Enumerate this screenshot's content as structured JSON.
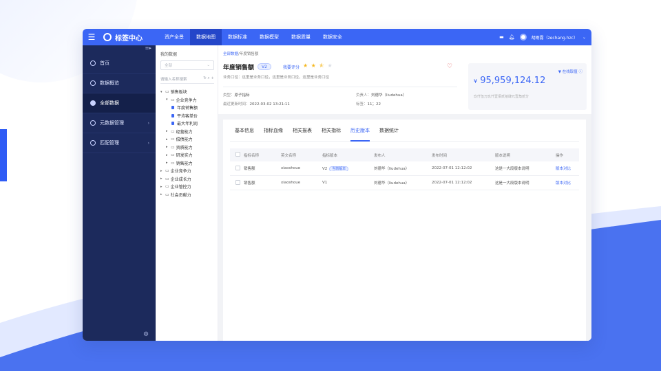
{
  "topbar": {
    "app_name": "标签中心",
    "nav": [
      "资产全景",
      "数据地图",
      "数据标准",
      "数据模型",
      "数据质量",
      "数据安全"
    ],
    "active_nav": 1,
    "user": "胡雨露（zechang.hzc）"
  },
  "sidebar": {
    "items": [
      {
        "label": "首页",
        "icon": "home-icon"
      },
      {
        "label": "数据概览",
        "icon": "overview-icon"
      },
      {
        "label": "全部数据",
        "icon": "pie-chart-icon"
      },
      {
        "label": "元数据管理",
        "icon": "metadata-icon"
      },
      {
        "label": "匹配管理",
        "icon": "match-icon"
      }
    ],
    "active_index": 2
  },
  "tree": {
    "title": "我的数据",
    "select_value": "全部",
    "search_placeholder": "请输入名称搜索",
    "nodes": [
      {
        "label": "销售板块",
        "level": 0,
        "type": "folder",
        "open": true
      },
      {
        "label": "企业竞争力",
        "level": 1,
        "type": "folder",
        "open": true
      },
      {
        "label": "年度销售额",
        "level": 2,
        "type": "db"
      },
      {
        "label": "平均客单价",
        "level": 2,
        "type": "db"
      },
      {
        "label": "最大年利润",
        "level": 2,
        "type": "db"
      },
      {
        "label": "经营能力",
        "level": 1,
        "type": "folder",
        "open": false
      },
      {
        "label": "偿债能力",
        "level": 1,
        "type": "folder",
        "open": false
      },
      {
        "label": "资质能力",
        "level": 1,
        "type": "folder",
        "open": false
      },
      {
        "label": "研发实力",
        "level": 1,
        "type": "folder",
        "open": false
      },
      {
        "label": "销售能力",
        "level": 1,
        "type": "folder",
        "open": false
      },
      {
        "label": "企业竞争力",
        "level": 0,
        "type": "folder",
        "open": false
      },
      {
        "label": "企业成长力",
        "level": 0,
        "type": "folder",
        "open": false
      },
      {
        "label": "企业管控力",
        "level": 0,
        "type": "folder",
        "open": false
      },
      {
        "label": "社会贡献力",
        "level": 0,
        "type": "folder",
        "open": false
      }
    ]
  },
  "header": {
    "breadcrumb_link": "全部数据",
    "breadcrumb_rest": "/年度销售额",
    "title": "年度销售额",
    "version": "V2",
    "rating_label": "我要评分",
    "rating": 2.5,
    "description": "业务口径：这里是业务口径，这里是业务口径，这里是业务口径",
    "type_label": "类型：",
    "type_value": "原子指标",
    "owner_label": "负责人：",
    "owner_value": "刘德华（liudehua）",
    "updated_label": "最近更新时间：",
    "updated_value": "2022-03-02 13:21:11",
    "tag_label": "标签：",
    "tag_value": "11；22"
  },
  "value_card": {
    "link": "在线取值",
    "currency": "¥",
    "value": "95,959,124.12",
    "note": "玖仟伍万玖仟壹佰贰拾肆元壹角贰分"
  },
  "tabs": [
    "基本信息",
    "指标血缘",
    "相关报表",
    "相关指标",
    "历史版本",
    "数据统计"
  ],
  "active_tab": 4,
  "table": {
    "headers": [
      "指标名称",
      "英文名称",
      "指标版本",
      "发布人",
      "发布时间",
      "版本说明",
      "操作"
    ],
    "current_tag": "当前版本",
    "rows": [
      {
        "name": "销售额",
        "en": "xiaoshoue",
        "ver": "V2",
        "current": true,
        "publisher": "刘德华（liudehua）",
        "time": "2022-07-01 12:12:02",
        "desc": "这是一大段版本说明",
        "op": "版本对比"
      },
      {
        "name": "销售额",
        "en": "xiaoshoue",
        "ver": "V1",
        "current": false,
        "publisher": "刘德华（liudehua）",
        "time": "2022-07-01 12:12:02",
        "desc": "这是一大段版本说明",
        "op": "版本对比"
      }
    ]
  },
  "colors": {
    "accent": "#3b66f5",
    "sidebar": "#1c2a5c",
    "star": "#f5b820"
  }
}
